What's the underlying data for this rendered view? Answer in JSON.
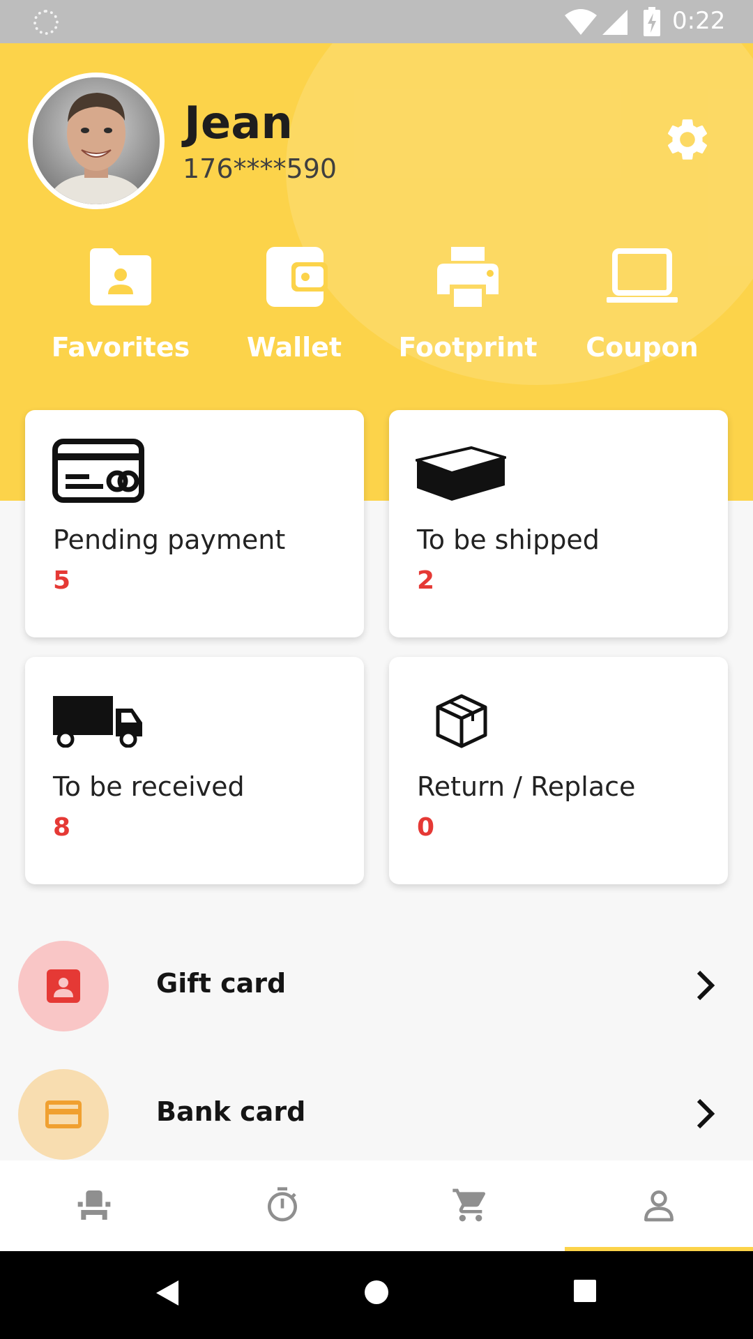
{
  "status_bar": {
    "time": "0:22"
  },
  "profile": {
    "name": "Jean",
    "phone": "176****590"
  },
  "quick_links": [
    {
      "label": "Favorites",
      "icon": "folder-user-icon"
    },
    {
      "label": "Wallet",
      "icon": "wallet-icon"
    },
    {
      "label": "Footprint",
      "icon": "printer-icon"
    },
    {
      "label": "Coupon",
      "icon": "laptop-icon"
    }
  ],
  "order_cards": [
    {
      "label": "Pending payment",
      "count": "5",
      "icon": "credit-card-icon"
    },
    {
      "label": "To be shipped",
      "count": "2",
      "icon": "box-lid-icon"
    },
    {
      "label": "To be received",
      "count": "8",
      "icon": "truck-icon"
    },
    {
      "label": "Return / Replace",
      "count": "0",
      "icon": "package-icon"
    }
  ],
  "list_items": [
    {
      "label": "Gift card",
      "icon": "contact-card-icon",
      "circle_color": "#f9c6c6",
      "icon_color": "#e53935"
    },
    {
      "label": "Bank card",
      "icon": "bank-card-icon",
      "circle_color": "#f8ddb0",
      "icon_color": "#f0a030"
    }
  ],
  "bottom_nav": [
    {
      "name": "home",
      "icon": "seat-icon"
    },
    {
      "name": "timer",
      "icon": "stopwatch-icon"
    },
    {
      "name": "cart",
      "icon": "cart-icon"
    },
    {
      "name": "profile",
      "icon": "person-icon",
      "active": true
    }
  ],
  "colors": {
    "accent": "#fcd34a",
    "count_red": "#e53935",
    "icon_gray": "#8f8f8f"
  }
}
